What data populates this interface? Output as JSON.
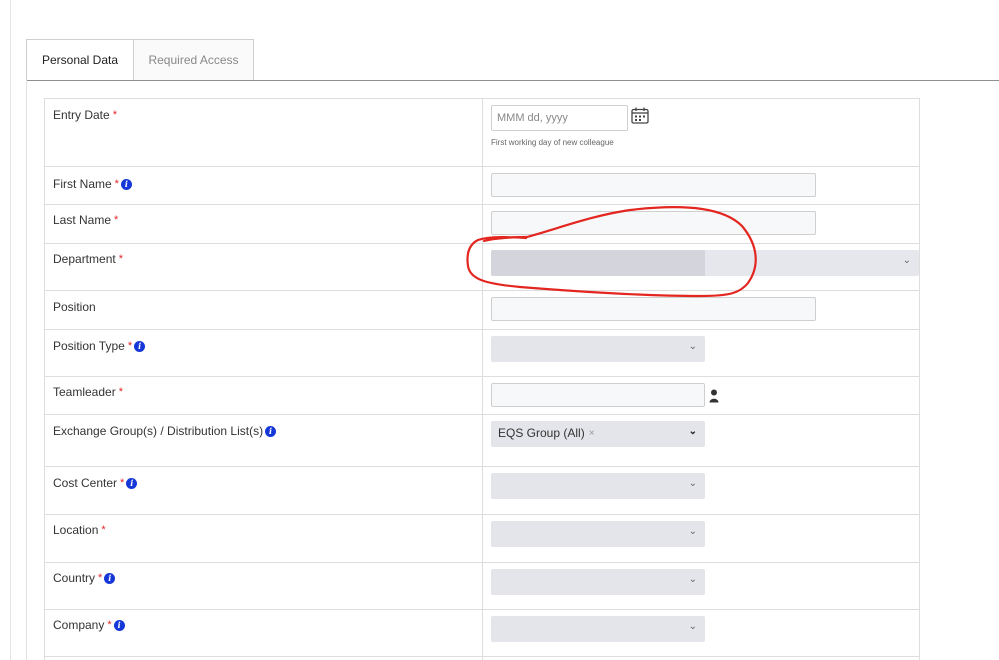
{
  "tabs": [
    {
      "label": "Personal Data",
      "active": true
    },
    {
      "label": "Required Access",
      "active": false
    }
  ],
  "fields": {
    "entry_date": {
      "label": "Entry Date",
      "required": "*",
      "placeholder": "MMM dd, yyyy",
      "helper": "First working day of new colleague"
    },
    "first_name": {
      "label": "First Name",
      "required": "*"
    },
    "last_name": {
      "label": "Last Name",
      "required": "*"
    },
    "department": {
      "label": "Department",
      "required": "*"
    },
    "position": {
      "label": "Position"
    },
    "position_type": {
      "label": "Position Type",
      "required": "*"
    },
    "teamleader": {
      "label": "Teamleader",
      "required": "*"
    },
    "exchange_groups": {
      "label": "Exchange Group(s) / Distribution List(s)",
      "selected_tag": "EQS Group (All)",
      "tag_remove": "×"
    },
    "cost_center": {
      "label": "Cost Center",
      "required": "*"
    },
    "location": {
      "label": "Location",
      "required": "*"
    },
    "country": {
      "label": "Country",
      "required": "*"
    },
    "company": {
      "label": "Company",
      "required": "*"
    }
  },
  "icons": {
    "info": "info-circle-icon",
    "calendar": "calendar-icon",
    "user": "user-icon",
    "chevron": "chevron-down-icon"
  },
  "colors": {
    "required": "#e0262b",
    "info": "#1537d8",
    "annotation": "#e3261f"
  }
}
